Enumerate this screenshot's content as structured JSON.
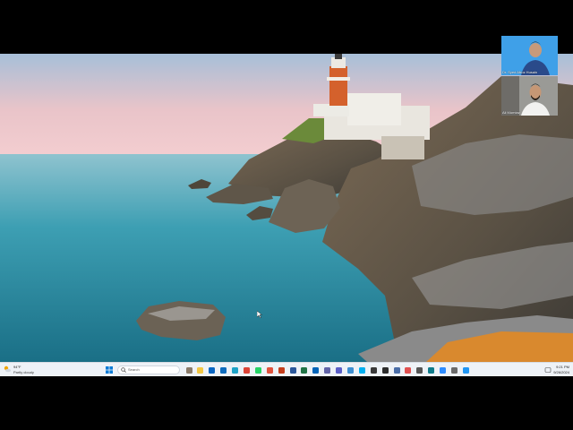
{
  "meeting": {
    "participants": [
      {
        "name": "Dr. Syed Afroz Husain"
      },
      {
        "name": "Ali Mumtaz"
      }
    ]
  },
  "taskbar": {
    "weather": {
      "temperature": "94°F",
      "condition": "Partly cloudy",
      "icon": "sun-cloud-icon"
    },
    "search": {
      "placeholder": "Search"
    },
    "apps": [
      {
        "name": "lighthouse-widget-icon",
        "color": "#8a7b6a"
      },
      {
        "name": "file-explorer-icon",
        "color": "#f2c744"
      },
      {
        "name": "linkedin-icon",
        "color": "#0a66c2"
      },
      {
        "name": "outlook-icon",
        "color": "#0f6cbd"
      },
      {
        "name": "edge-icon",
        "color": "#1fa3c7"
      },
      {
        "name": "chrome-icon",
        "color": "#db4437"
      },
      {
        "name": "whatsapp-icon",
        "color": "#25d366"
      },
      {
        "name": "chrome-profile-icon",
        "color": "#e0533d"
      },
      {
        "name": "powerpoint-icon",
        "color": "#c43e1c"
      },
      {
        "name": "word-icon",
        "color": "#2b579a"
      },
      {
        "name": "excel-icon",
        "color": "#217346"
      },
      {
        "name": "onedrive-icon",
        "color": "#0364b8"
      },
      {
        "name": "teams-icon",
        "color": "#6264a7"
      },
      {
        "name": "teams-work-icon",
        "color": "#5b5fc7"
      },
      {
        "name": "vpn-icon",
        "color": "#3e8fd1"
      },
      {
        "name": "skype-icon",
        "color": "#00aff0"
      },
      {
        "name": "app-five-icon",
        "color": "#3a3a3a"
      },
      {
        "name": "terminal-icon",
        "color": "#2d2d2d"
      },
      {
        "name": "notepad-icon",
        "color": "#4a6da7"
      },
      {
        "name": "photos-icon",
        "color": "#e05050"
      },
      {
        "name": "calculator-icon",
        "color": "#555555"
      },
      {
        "name": "phone-link-icon",
        "color": "#0f7b8a"
      },
      {
        "name": "zoom-icon",
        "color": "#2d8cff"
      },
      {
        "name": "settings-icon",
        "color": "#6b6b6b"
      },
      {
        "name": "copilot-icon",
        "color": "#2196f3"
      }
    ],
    "clock": {
      "time": "9:21 PM",
      "date": "9/26/2024"
    }
  }
}
